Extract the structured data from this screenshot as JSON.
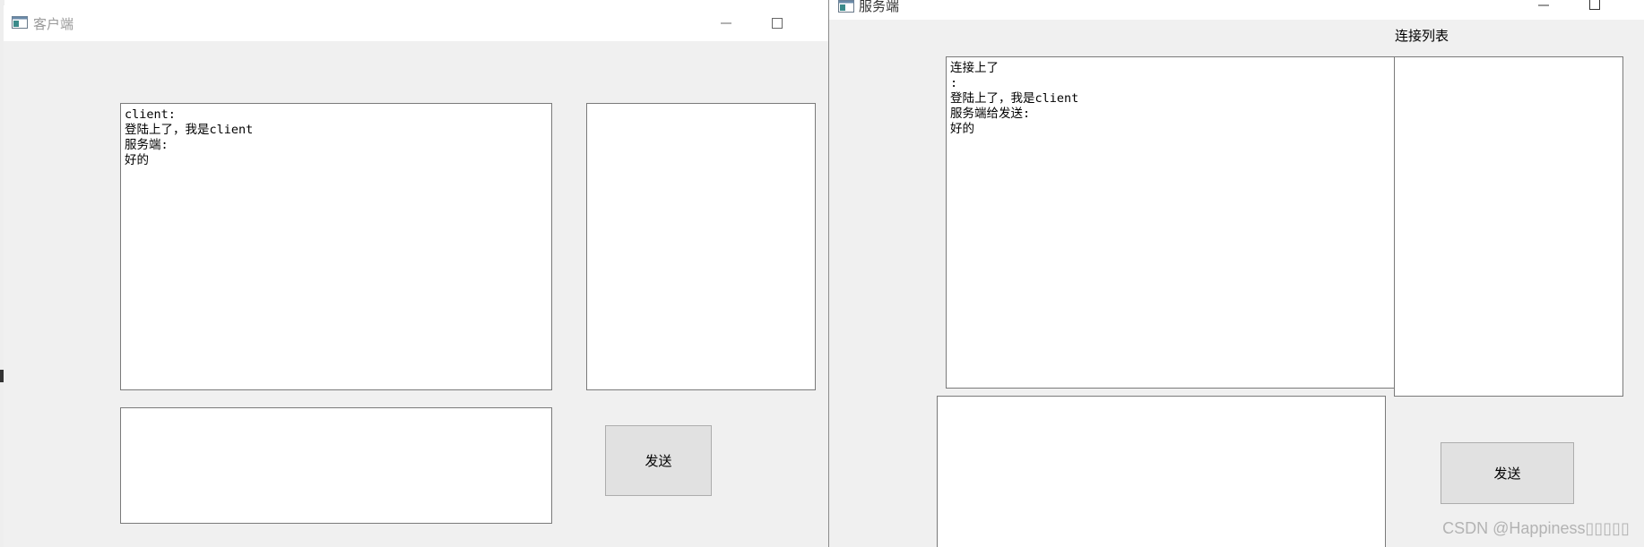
{
  "client": {
    "title": "客户端",
    "chat_log": "client:\n登陆上了，我是client\n服务端:\n好的",
    "message_value": "",
    "send_label": "发送"
  },
  "server": {
    "title": "服务端",
    "connection_list_label": "连接列表",
    "chat_log": "连接上了\n:\n登陆上了，我是client\n服务端给发送:\n好的",
    "message_value": "",
    "send_label": "发送"
  },
  "watermark": "CSDN @Happiness▯▯▯▯▯"
}
